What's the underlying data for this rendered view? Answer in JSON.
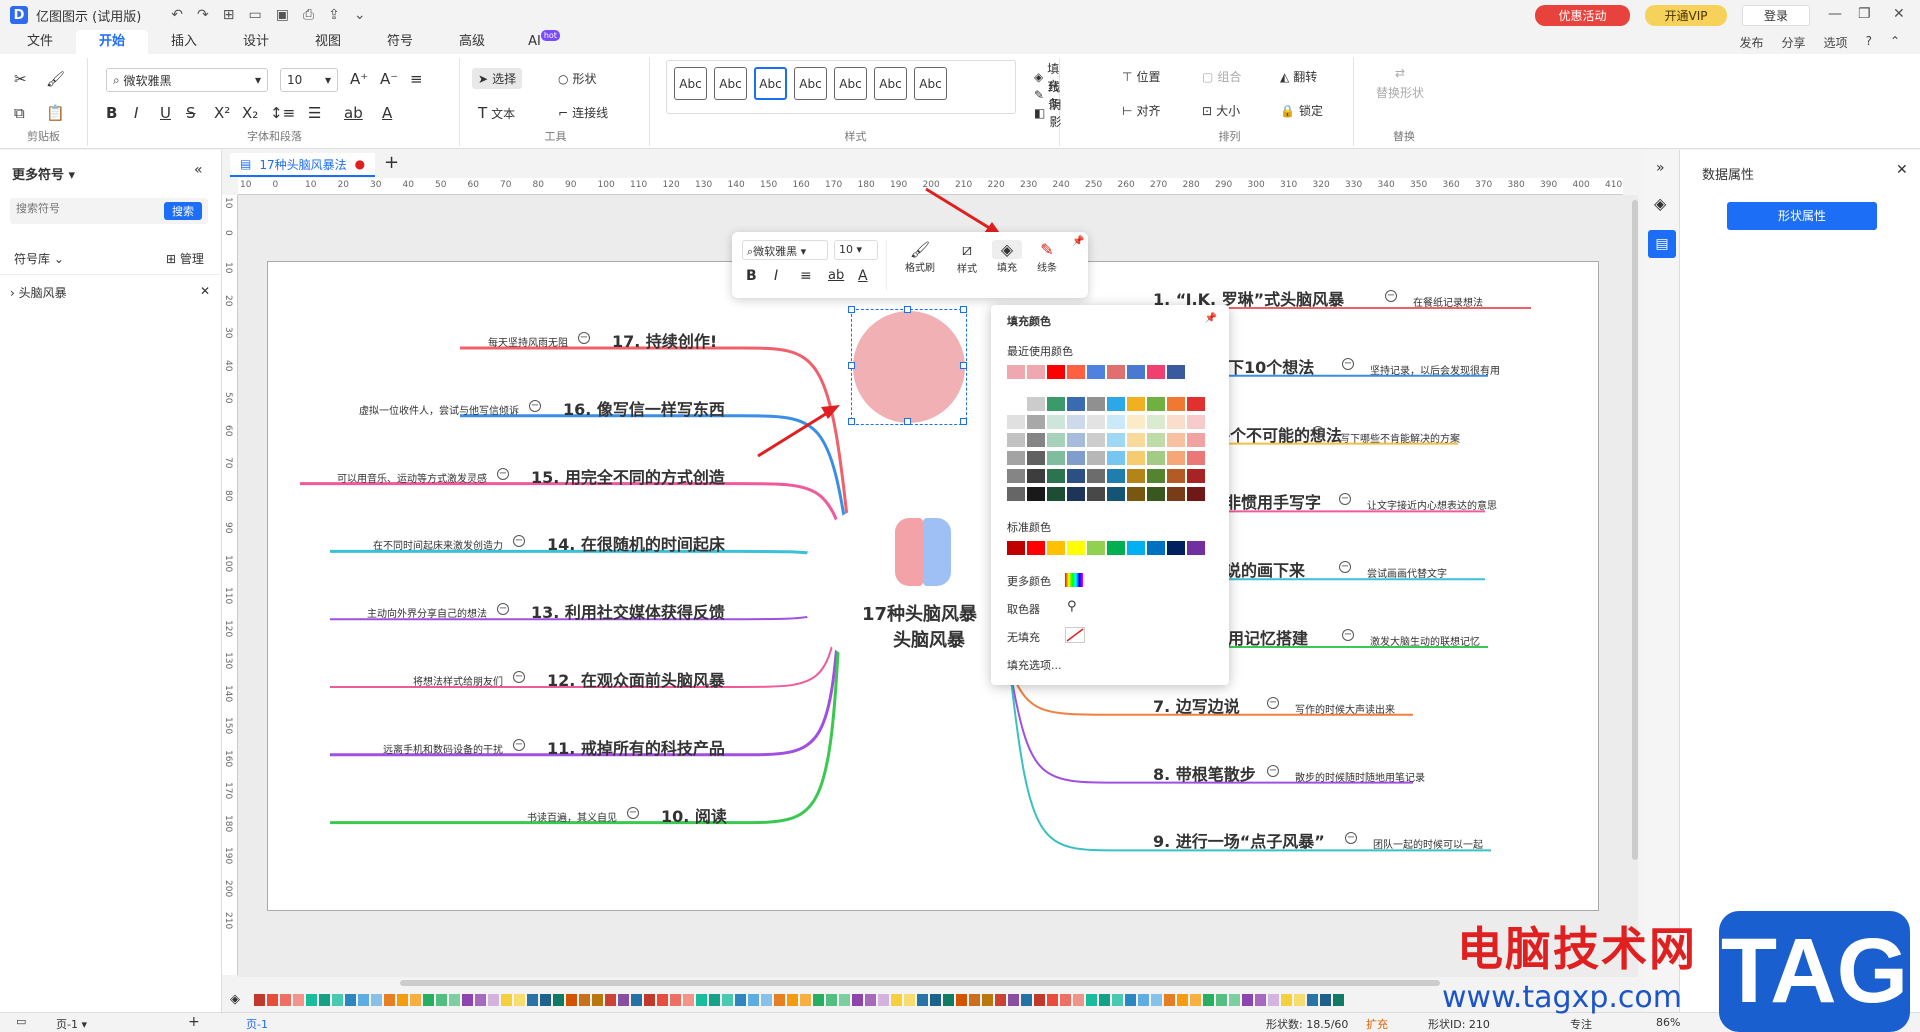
{
  "app": {
    "logo": "D",
    "title": "亿图图示 (试用版)",
    "promo": "优惠活动",
    "vip": "开通VIP",
    "login": "登录"
  },
  "menu": {
    "items": [
      "文件",
      "开始",
      "插入",
      "设计",
      "视图",
      "符号",
      "高级",
      "AI"
    ],
    "hot": "hot",
    "right": [
      "发布",
      "分享",
      "选项"
    ]
  },
  "ribbon": {
    "font_name": "微软雅黑",
    "font_size": "10",
    "groups": {
      "clipboard": "剪贴板",
      "font": "字体和段落",
      "tools": "工具",
      "styles": "样式",
      "arrange": "排列",
      "replace": "替换"
    },
    "select": "选择",
    "shape": "形状",
    "text": "文本",
    "connector": "连接线",
    "style_samples": [
      "Abc",
      "Abc",
      "Abc",
      "Abc",
      "Abc",
      "Abc",
      "Abc"
    ],
    "fill": "填充",
    "line": "线条",
    "shadow": "阴影",
    "position": "位置",
    "group": "组合",
    "flip": "翻转",
    "align": "对齐",
    "size": "大小",
    "lock": "锁定",
    "replace_shape": "替换形状"
  },
  "left_panel": {
    "title": "更多符号",
    "search_placeholder": "搜索符号",
    "search_btn": "搜索",
    "library": "符号库",
    "manage": "管理",
    "item": "头脑风暴"
  },
  "tab": {
    "name": "17种头脑风暴法"
  },
  "ruler_h": [
    "10",
    "0",
    "10",
    "20",
    "30",
    "40",
    "50",
    "60",
    "70",
    "80",
    "90",
    "100",
    "110",
    "120",
    "130",
    "140",
    "150",
    "160",
    "170",
    "180",
    "190",
    "200",
    "210",
    "220",
    "230",
    "240",
    "250",
    "260",
    "270",
    "280",
    "290",
    "300",
    "310",
    "320",
    "330",
    "340",
    "350",
    "360",
    "370",
    "380",
    "390",
    "400",
    "410"
  ],
  "ruler_v": [
    "10",
    "0",
    "10",
    "20",
    "30",
    "40",
    "50",
    "60",
    "70",
    "80",
    "90",
    "100",
    "110",
    "120",
    "130",
    "140",
    "150",
    "160",
    "170",
    "180",
    "190",
    "200",
    "210"
  ],
  "center": {
    "line1": "17种头脑风暴",
    "line2": "头脑风暴"
  },
  "left_nodes": [
    {
      "title": "17. 持续创作!",
      "note": "每天坚持风雨无阻",
      "color": "#f0606a"
    },
    {
      "title": "16. 像写信一样写东西",
      "note": "虚拟一位收件人，尝试与他写信倾诉",
      "color": "#3a8ee6"
    },
    {
      "title": "15. 用完全不同的方式创造",
      "note": "可以用音乐、运动等方式激发灵感",
      "color": "#f05a9a"
    },
    {
      "title": "14. 在很随机的时间起床",
      "note": "在不同时间起床来激发创造力",
      "color": "#3ac0d8"
    },
    {
      "title": "13. 利用社交媒体获得反馈",
      "note": "主动向外界分享自己的想法",
      "color": "#a050e0"
    },
    {
      "title": "12. 在观众面前头脑风暴",
      "note": "将想法样式给朋友们",
      "color": "#f05a9a"
    },
    {
      "title": "11. 戒掉所有的科技产品",
      "note": "远离手机和数码设备的干扰",
      "color": "#a050e0"
    },
    {
      "title": "10. 阅读",
      "note": "书读百遍，其义自见",
      "color": "#3ac850"
    }
  ],
  "right_nodes": [
    {
      "title": "1. “J.K. 罗琳”式头脑风暴",
      "note": "在餐纸记录想法",
      "color": "#f0606a"
    },
    {
      "title": "下10个想法",
      "note": "坚持记录，以后会发现很有用",
      "color": "#3a8ee6"
    },
    {
      "title": "录每个不可能的想法",
      "note": "写下哪些不肯能解决的方案",
      "color": "#f0c040"
    },
    {
      "title": "非惯用手写字",
      "note": "让文字接近内心想表达的意思",
      "color": "#f05a9a"
    },
    {
      "title": "说的画下来",
      "note": "尝试画画代替文字",
      "color": "#3ac0d8"
    },
    {
      "title": "用记忆搭建",
      "note": "激发大脑生动的联想记忆",
      "color": "#3ac850"
    },
    {
      "title": "7. 边写边说",
      "note": "写作的时候大声读出来",
      "color": "#f08040"
    },
    {
      "title": "8. 带根笔散步",
      "note": "散步的时候随时随地用笔记录",
      "color": "#a050e0"
    },
    {
      "title": "9. 进行一场“点子风暴”",
      "note": "团队一起的时候可以一起",
      "color": "#3ac0c0"
    }
  ],
  "float_toolbar": {
    "font": "微软雅黑",
    "size": "10",
    "format_painter": "格式刷",
    "style": "样式",
    "fill": "填充",
    "line": "线条"
  },
  "fill_panel": {
    "title": "填充颜色",
    "recent": "最近使用颜色",
    "standard": "标准颜色",
    "more": "更多颜色",
    "picker": "取色器",
    "none": "无填充",
    "options": "填充选项...",
    "recent_colors": [
      "#f0a8b0",
      "#f0a8b0",
      "#ff0000",
      "#ff6040",
      "#5080e0",
      "#e07070",
      "#4a7ad0",
      "#f04070",
      "#3a5aa0"
    ],
    "base_colors": [
      "#ffffff",
      "#000000",
      "#3a9a6a",
      "#3a6ab0",
      "#909090",
      "#2aa8e8",
      "#f0b020",
      "#70b040",
      "#f07830",
      "#e03030"
    ],
    "standard_colors": [
      "#c00000",
      "#ff0000",
      "#ffc000",
      "#ffff00",
      "#92d050",
      "#00b050",
      "#00b0f0",
      "#0070c0",
      "#002060",
      "#7030a0"
    ]
  },
  "right_panel": {
    "title": "数据属性",
    "button": "形状属性"
  },
  "status": {
    "page": "页-1",
    "page_tab": "页-1",
    "shape_count_label": "形状数:",
    "shape_count": "18.5/60",
    "expand": "扩充",
    "shape_id_label": "形状ID:",
    "shape_id": "210",
    "focus": "专注",
    "zoom": "86%"
  },
  "watermark": {
    "text": "电脑技术网",
    "url": "www.tagxp.com",
    "tag": "TAG"
  }
}
